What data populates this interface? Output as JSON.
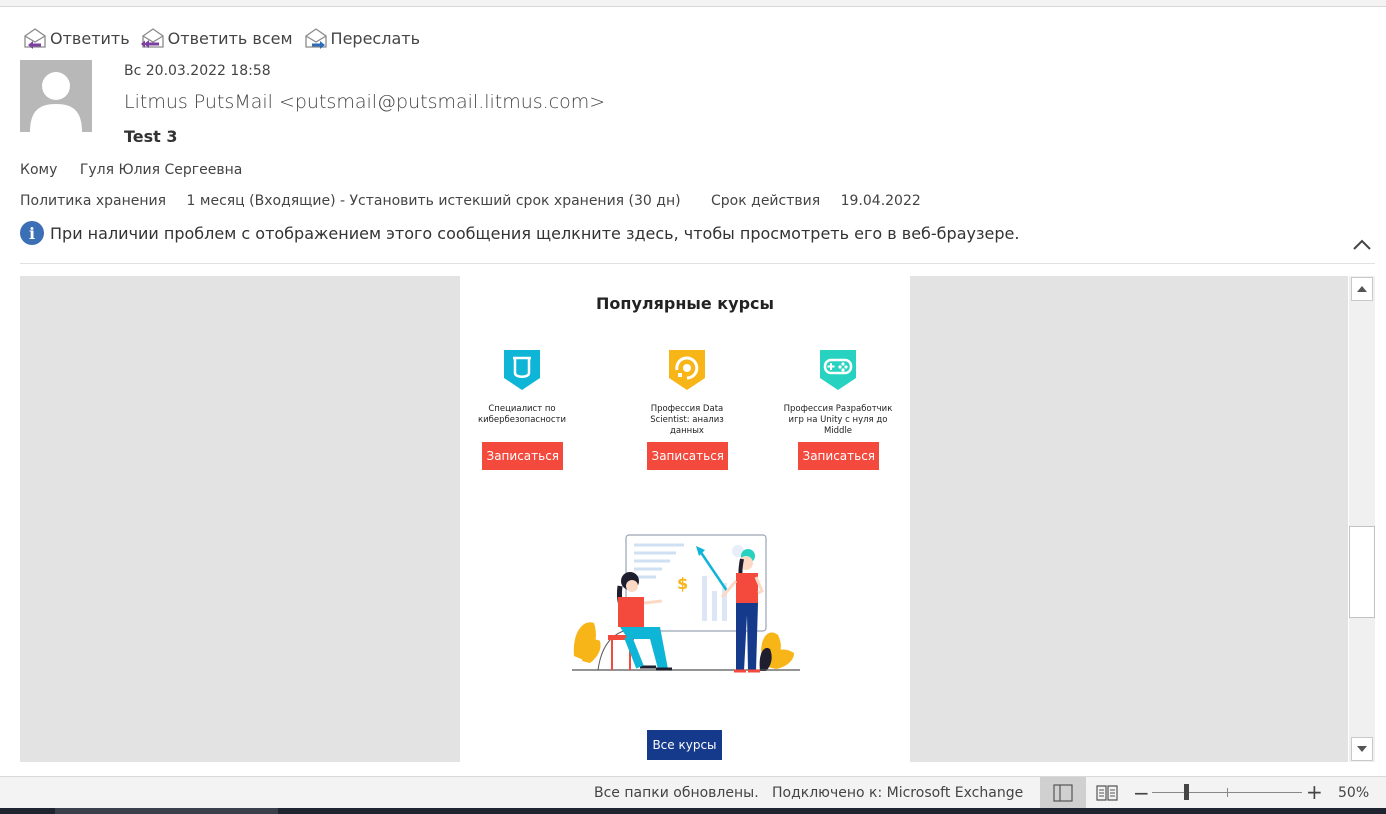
{
  "toolbar": {
    "reply": "Ответить",
    "reply_all": "Ответить всем",
    "forward": "Переслать"
  },
  "message": {
    "date": "Вс 20.03.2022 18:58",
    "sender": "Litmus PutsMail <putsmail@putsmail.litmus.com>",
    "subject": "Test 3",
    "to_label": "Кому",
    "to_value": "Гуля Юлия Сергеевна",
    "policy_label": "Политика хранения",
    "policy_value": "1 месяц (Входящие) - Установить истекший срок хранения (30 дн)",
    "expiry_label": "Срок действия",
    "expiry_value": "19.04.2022",
    "info_text": "При наличии проблем с отображением этого сообщения щелкните здесь, чтобы просмотреть его в веб-браузере."
  },
  "email": {
    "heading": "Популярные курсы",
    "courses": [
      {
        "name": "Специалист по кибербезопасности",
        "button": "Записаться",
        "icon": "shield-icon",
        "color": "#0fb5d6"
      },
      {
        "name": "Профессия Data Scientist: анализ данных",
        "button": "Записаться",
        "icon": "data-science-icon",
        "color": "#f7b518"
      },
      {
        "name": "Профессия Разработчик игр на Unity с нуля до Middle",
        "button": "Записаться",
        "icon": "gamepad-icon",
        "color": "#27d2c0"
      }
    ],
    "all_courses": "Все курсы"
  },
  "status": {
    "folders": "Все папки обновлены.",
    "connection": "Подключено к: Microsoft Exchange",
    "zoom": "50%"
  }
}
